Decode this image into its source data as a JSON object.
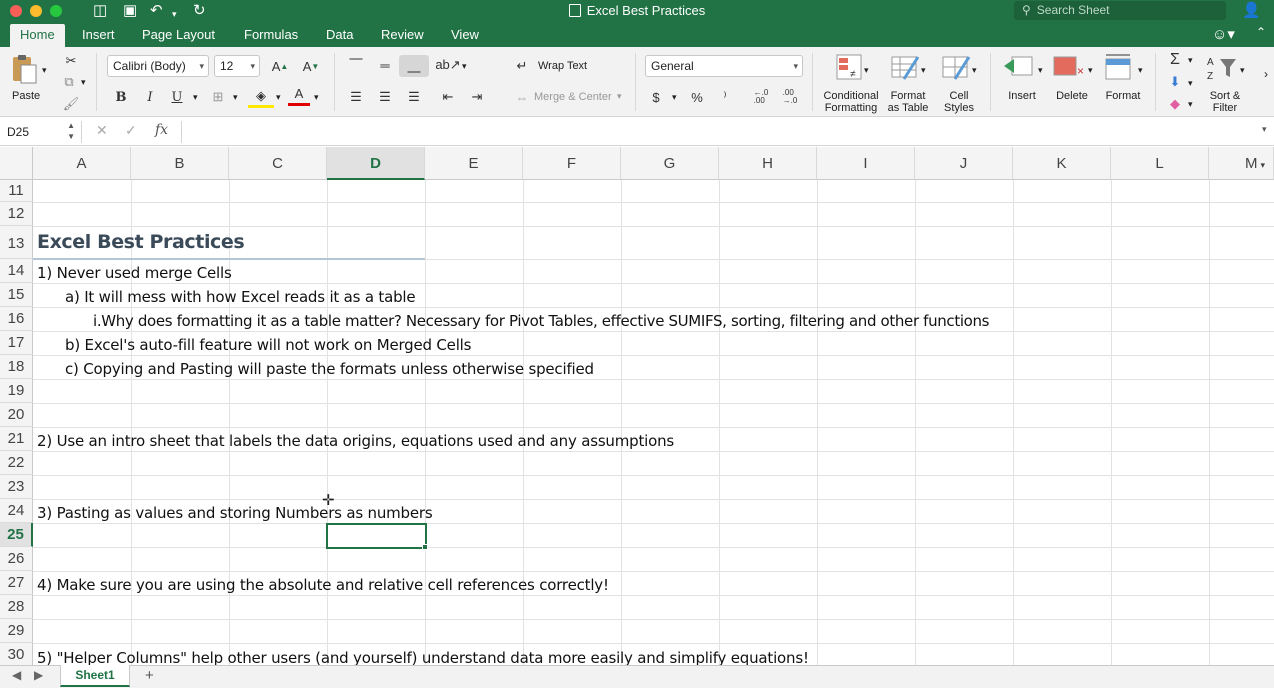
{
  "window": {
    "title": "Excel Best Practices",
    "search_placeholder": "Search Sheet"
  },
  "tabs": [
    "Home",
    "Insert",
    "Page Layout",
    "Formulas",
    "Data",
    "Review",
    "View"
  ],
  "ribbon": {
    "paste_label": "Paste",
    "font_name": "Calibri (Body)",
    "font_size": "12",
    "bold": "B",
    "italic": "I",
    "underline": "U",
    "font_color_glyph": "A",
    "wrap_text": "Wrap Text",
    "merge_center": "Merge & Center",
    "number_format": "General",
    "currency": "$",
    "percent": "%",
    "comma": "⁾",
    "increase_decimal": "←.0\n.00",
    "decrease_decimal": ".00\n→.0",
    "conditional_formatting": "Conditional\nFormatting",
    "format_as_table": "Format\nas Table",
    "cell_styles": "Cell\nStyles",
    "insert": "Insert",
    "delete": "Delete",
    "format": "Format",
    "sort_filter": "Sort &\nFilter"
  },
  "formula_bar": {
    "name_box": "D25",
    "fx": "fx",
    "content": ""
  },
  "columns": [
    "A",
    "B",
    "C",
    "D",
    "E",
    "F",
    "G",
    "H",
    "I",
    "J",
    "K",
    "L",
    "M"
  ],
  "selected_column": "D",
  "rows": [
    "11",
    "12",
    "13",
    "14",
    "15",
    "16",
    "17",
    "18",
    "19",
    "20",
    "21",
    "22",
    "23",
    "24",
    "25",
    "26",
    "27",
    "28",
    "29",
    "30"
  ],
  "selected_row": "25",
  "cells": {
    "r13": "Excel Best Practices",
    "r14": "1) Never used merge Cells",
    "r15": "a) It will mess with how Excel reads it as a table",
    "r16": "i.Why does formatting it as a table matter? Necessary for Pivot Tables, effective SUMIFS, sorting, filtering and other functions",
    "r17": "b) Excel's auto-fill feature will not work on Merged Cells",
    "r18": "c) Copying and Pasting will paste the formats unless otherwise specified",
    "r21": "2) Use an intro sheet that labels the data origins, equations used and any assumptions",
    "r24": "3) Pasting as values and storing Numbers as numbers",
    "r27": "4) Make sure you are using the absolute and relative cell references correctly!",
    "r30": "5) \"Helper Columns\" help other users (and yourself) understand data more easily and simplify equations!"
  },
  "sheets": [
    "Sheet1"
  ],
  "colors": {
    "accent": "#217346",
    "title_text": "#3b4a59"
  }
}
